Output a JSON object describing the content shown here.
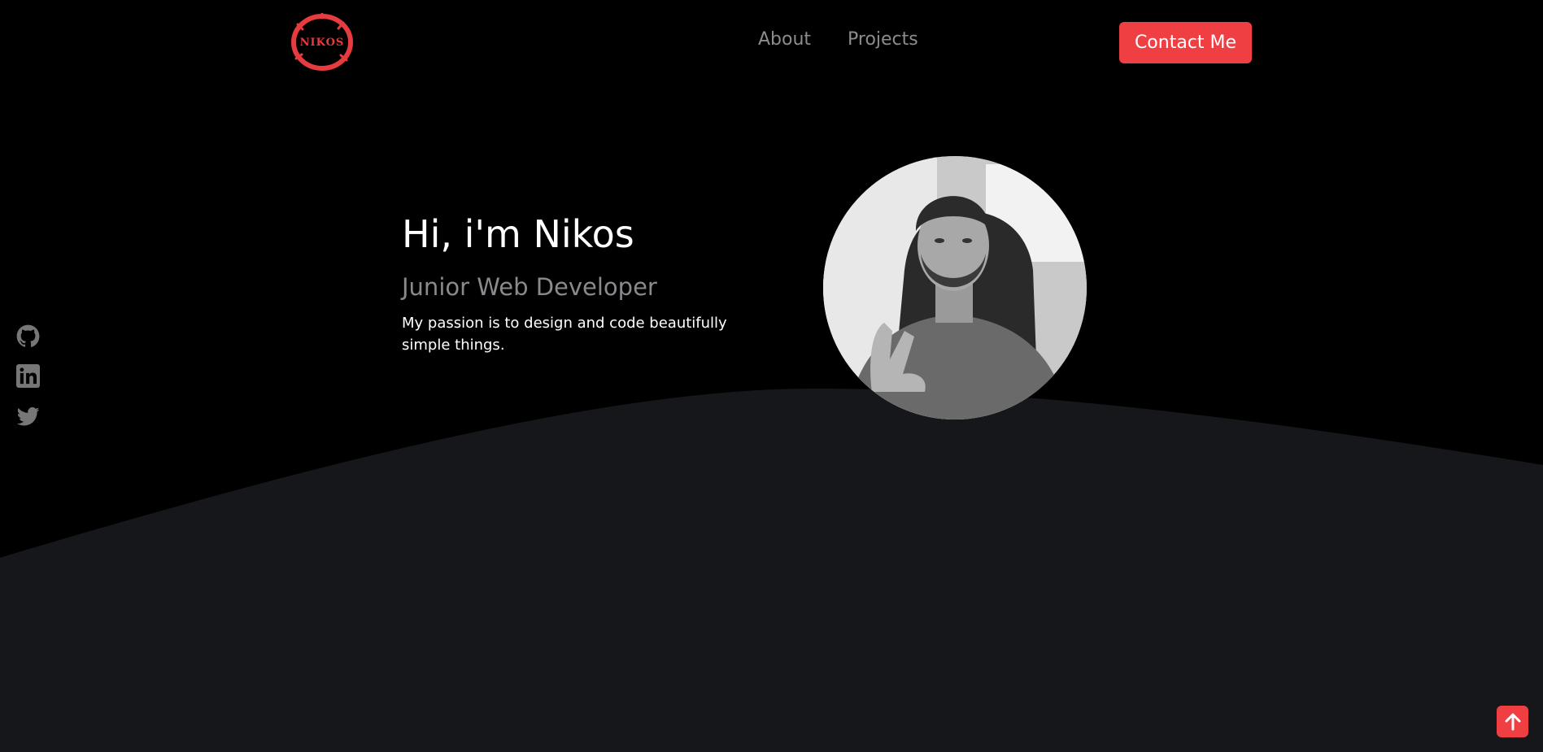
{
  "header": {
    "logo_text": "NIKOS",
    "nav": [
      {
        "label": "About"
      },
      {
        "label": "Projects"
      }
    ],
    "contact_label": "Contact Me"
  },
  "hero": {
    "title": "Hi, i'm Nikos",
    "subtitle": "Junior Web Developer",
    "description": "My passion is to design and code beautifully simple things."
  },
  "social": [
    {
      "icon": "github-icon"
    },
    {
      "icon": "linkedin-icon"
    },
    {
      "icon": "twitter-icon"
    }
  ],
  "scroll_top": {
    "icon": "arrow-up-icon"
  },
  "colors": {
    "background": "#000000",
    "wave": "#16171b",
    "accent": "#ef3f43",
    "nav_text": "#8c8c8c",
    "subtitle_text": "#8a8a8e",
    "social_icon": "#777777"
  }
}
